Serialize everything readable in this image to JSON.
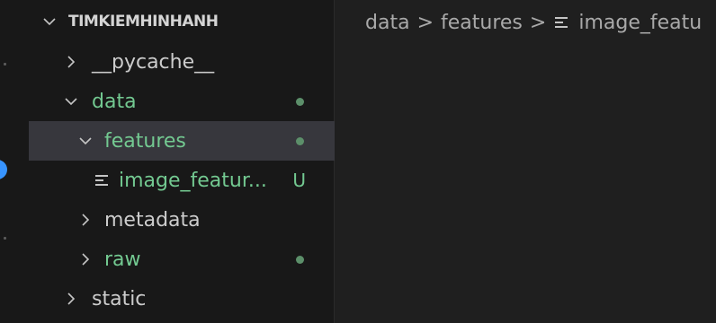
{
  "explorer": {
    "root": {
      "label": "TIMKIEMHINHANH",
      "expanded": true
    },
    "items": [
      {
        "label": "__pycache__",
        "type": "folder",
        "expanded": false,
        "level": 1,
        "status": ""
      },
      {
        "label": "data",
        "type": "folder",
        "expanded": true,
        "level": 1,
        "status": "modified"
      },
      {
        "label": "features",
        "type": "folder",
        "expanded": true,
        "level": 2,
        "status": "modified",
        "selected": true
      },
      {
        "label": "image_featur...",
        "type": "file",
        "level": 3,
        "status": "untracked",
        "status_text": "U"
      },
      {
        "label": "metadata",
        "type": "folder",
        "expanded": false,
        "level": 2,
        "status": ""
      },
      {
        "label": "raw",
        "type": "folder",
        "expanded": false,
        "level": 2,
        "status": "modified"
      },
      {
        "label": "static",
        "type": "folder",
        "expanded": false,
        "level": 1,
        "status": ""
      }
    ]
  },
  "breadcrumb": {
    "items": [
      "data",
      "features",
      "image_featu"
    ],
    "separator": ">"
  },
  "colors": {
    "green_text": "#73c991",
    "modified_dot": "#5c8f6a",
    "selected_bg": "#37373d",
    "accent_blue": "#3794ff"
  },
  "icons": {
    "chevron_right": "chevron-right-icon",
    "chevron_down": "chevron-down-icon",
    "file": "lines-file-icon"
  }
}
